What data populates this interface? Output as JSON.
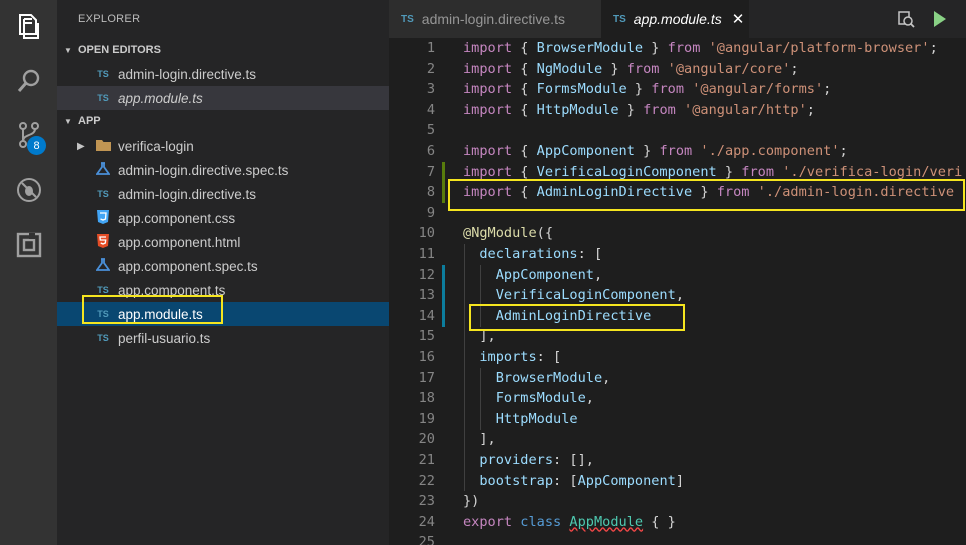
{
  "activity_bar": {
    "scm_badge": "8"
  },
  "sidebar": {
    "title": "EXPLORER",
    "open_editors": {
      "header": "OPEN EDITORS",
      "items": [
        {
          "icon": "TS",
          "label": "admin-login.directive.ts"
        },
        {
          "icon": "TS",
          "label": "app.module.ts"
        }
      ]
    },
    "app": {
      "header": "APP",
      "items": [
        {
          "icon": "folder",
          "label": "verifica-login"
        },
        {
          "icon": "spec",
          "label": "admin-login.directive.spec.ts"
        },
        {
          "icon": "TS",
          "label": "admin-login.directive.ts"
        },
        {
          "icon": "CSS",
          "label": "app.component.css"
        },
        {
          "icon": "HTML",
          "label": "app.component.html"
        },
        {
          "icon": "spec",
          "label": "app.component.spec.ts"
        },
        {
          "icon": "TS",
          "label": "app.component.ts"
        },
        {
          "icon": "TS",
          "label": "app.module.ts"
        },
        {
          "icon": "TS",
          "label": "perfil-usuario.ts"
        }
      ]
    }
  },
  "tabs": [
    {
      "icon": "TS",
      "label": "admin-login.directive.ts"
    },
    {
      "icon": "TS",
      "label": "app.module.ts",
      "close": "✕"
    }
  ],
  "editor": {
    "line_numbers": [
      "1",
      "2",
      "3",
      "4",
      "5",
      "6",
      "7",
      "8",
      "9",
      "10",
      "11",
      "12",
      "13",
      "14",
      "15",
      "16",
      "17",
      "18",
      "19",
      "20",
      "21",
      "22",
      "23",
      "24",
      "25"
    ],
    "l1": {
      "a": "import",
      "b": " { ",
      "c": "BrowserModule",
      "d": " } ",
      "e": "from",
      "f": " ",
      "g": "'@angular/platform-browser'",
      "h": ";"
    },
    "l2": {
      "a": "import",
      "b": " { ",
      "c": "NgModule",
      "d": " } ",
      "e": "from",
      "f": " ",
      "g": "'@angular/core'",
      "h": ";"
    },
    "l3": {
      "a": "import",
      "b": " { ",
      "c": "FormsModule",
      "d": " } ",
      "e": "from",
      "f": " ",
      "g": "'@angular/forms'",
      "h": ";"
    },
    "l4": {
      "a": "import",
      "b": " { ",
      "c": "HttpModule",
      "d": " } ",
      "e": "from",
      "f": " ",
      "g": "'@angular/http'",
      "h": ";"
    },
    "l6": {
      "a": "import",
      "b": " { ",
      "c": "AppComponent",
      "d": " } ",
      "e": "from",
      "f": " ",
      "g": "'./app.component'",
      "h": ";"
    },
    "l7": {
      "a": "import",
      "b": " { ",
      "c": "VerificaLoginComponent",
      "d": " } ",
      "e": "from",
      "f": " ",
      "g": "'./verifica-login/veri"
    },
    "l8": {
      "a": "import",
      "b": " { ",
      "c": "AdminLoginDirective",
      "d": " } ",
      "e": "from",
      "f": " ",
      "g": "'./admin-login.directive"
    },
    "l10": {
      "a": "@",
      "b": "NgModule",
      "c": "({"
    },
    "l11": {
      "a": "  ",
      "b": "declarations",
      "c": ": ["
    },
    "l12": {
      "a": "    ",
      "b": "AppComponent",
      "c": ","
    },
    "l13": {
      "a": "    ",
      "b": "VerificaLoginComponent",
      "c": ","
    },
    "l14": {
      "a": "    ",
      "b": "AdminLoginDirective"
    },
    "l15": {
      "a": "  ],"
    },
    "l16": {
      "a": "  ",
      "b": "imports",
      "c": ": ["
    },
    "l17": {
      "a": "    ",
      "b": "BrowserModule",
      "c": ","
    },
    "l18": {
      "a": "    ",
      "b": "FormsModule",
      "c": ","
    },
    "l19": {
      "a": "    ",
      "b": "HttpModule"
    },
    "l20": {
      "a": "  ],"
    },
    "l21": {
      "a": "  ",
      "b": "providers",
      "c": ": [],"
    },
    "l22": {
      "a": "  ",
      "b": "bootstrap",
      "c": ": [",
      "d": "AppComponent",
      "e": "]"
    },
    "l23": {
      "a": "})"
    },
    "l24": {
      "a": "export",
      "b": " ",
      "c": "class",
      "d": " ",
      "e": "AppModule",
      "f": " { }"
    }
  },
  "colors": {
    "highlight_box": "#f5e51f",
    "selection": "#094771",
    "accent": "#007acc"
  }
}
